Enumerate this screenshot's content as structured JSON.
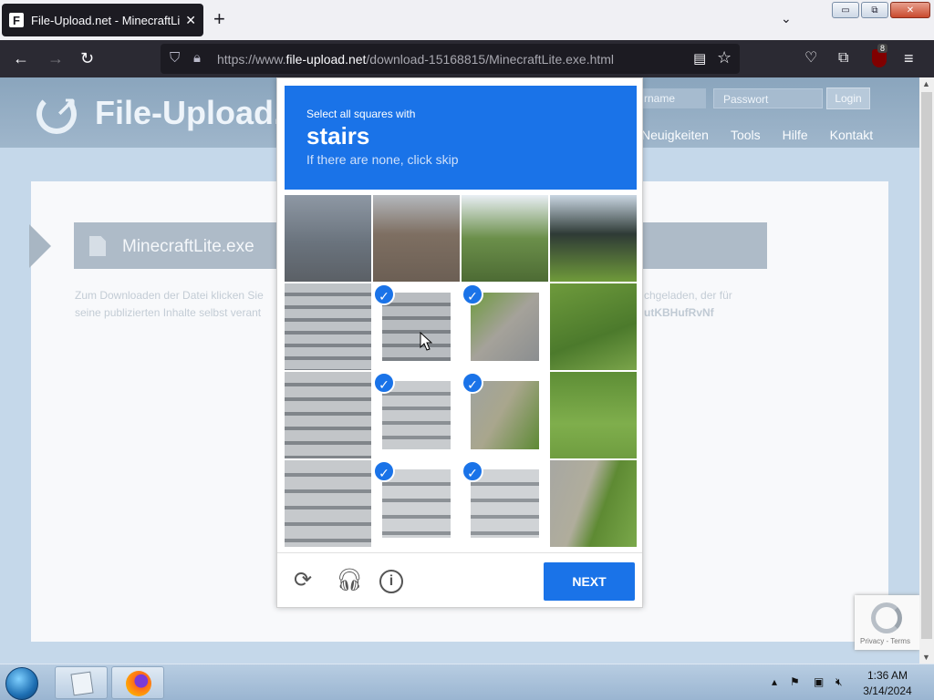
{
  "browser": {
    "tab_title": "File-Upload.net - MinecraftLite.",
    "tab_favicon": "F",
    "tab_close": "✕",
    "new_tab": "+",
    "list_tabs": "⌄",
    "url_host_prefix": "https://www.",
    "url_host": "file-upload.net",
    "url_path": "/download-15168815/MinecraftLite.exe.html",
    "addon_badge": "8",
    "window_buttons": [
      "▭",
      "⧉",
      "✕"
    ]
  },
  "site": {
    "logo_text": "File-Upload.n",
    "username_placeholder": "rname",
    "password_placeholder": "Passwort",
    "login_label": "Login",
    "nav": [
      "Neuigkeiten",
      "Tools",
      "Hilfe",
      "Kontakt"
    ],
    "file_name": "MinecraftLite.exe",
    "desc_line1": "Zum Downloaden der Datei klicken Sie",
    "desc_line2": "seine publizierten Inhalte selbst verant",
    "desc_line3": "chgeladen, der für",
    "desc_line4": "utKBHufRvNf",
    "recaptcha_links": "Privacy - Terms"
  },
  "captcha": {
    "instruction_small": "Select all squares with",
    "target_word": "stairs",
    "hint": "If there are none, click skip",
    "next_label": "NEXT",
    "check_glyph": "✓",
    "selected_cells": [
      5,
      6,
      9,
      10,
      13,
      14
    ],
    "icons": [
      "refresh-icon",
      "headphones-icon",
      "info-icon"
    ]
  },
  "taskbar": {
    "time": "1:36 AM",
    "date": "3/14/2024"
  }
}
